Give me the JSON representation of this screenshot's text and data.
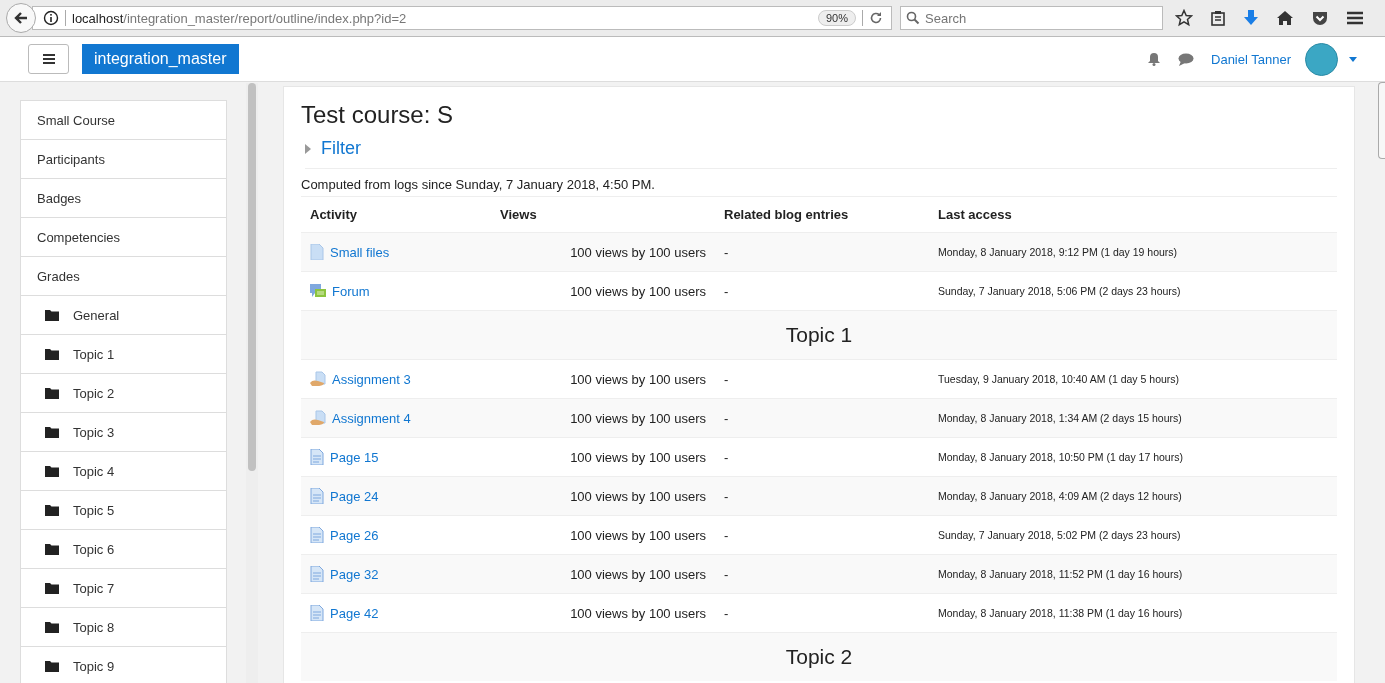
{
  "browser": {
    "url_host": "localhost",
    "url_path": "/integration_master/report/outline/index.php?id=2",
    "zoom": "90%",
    "search_placeholder": "Search"
  },
  "navbar": {
    "site_name": "integration_master",
    "user_name": "Daniel Tanner"
  },
  "sidebar": {
    "items": [
      {
        "label": "Small Course",
        "kind": "link"
      },
      {
        "label": "Participants",
        "kind": "link"
      },
      {
        "label": "Badges",
        "kind": "link"
      },
      {
        "label": "Competencies",
        "kind": "link"
      },
      {
        "label": "Grades",
        "kind": "link"
      },
      {
        "label": "General",
        "kind": "folder"
      },
      {
        "label": "Topic 1",
        "kind": "folder"
      },
      {
        "label": "Topic 2",
        "kind": "folder"
      },
      {
        "label": "Topic 3",
        "kind": "folder"
      },
      {
        "label": "Topic 4",
        "kind": "folder"
      },
      {
        "label": "Topic 5",
        "kind": "folder"
      },
      {
        "label": "Topic 6",
        "kind": "folder"
      },
      {
        "label": "Topic 7",
        "kind": "folder"
      },
      {
        "label": "Topic 8",
        "kind": "folder"
      },
      {
        "label": "Topic 9",
        "kind": "folder"
      }
    ]
  },
  "page": {
    "title": "Test course: S",
    "filter": "Filter",
    "note": "Computed from logs since Sunday, 7 January 2018, 4:50 PM.",
    "columns": [
      "Activity",
      "Views",
      "Related blog entries",
      "Last access"
    ],
    "rows": [
      {
        "kind": "file",
        "name": "Small files",
        "views": "100 views by 100 users",
        "blog": "-",
        "last_access": "Monday, 8 January 2018, 9:12 PM (1 day 19 hours)"
      },
      {
        "kind": "forum",
        "name": "Forum",
        "views": "100 views by 100 users",
        "blog": "-",
        "last_access": "Sunday, 7 January 2018, 5:06 PM (2 days 23 hours)"
      },
      {
        "kind": "section",
        "name": "Topic 1"
      },
      {
        "kind": "assignment",
        "name": "Assignment 3",
        "views": "100 views by 100 users",
        "blog": "-",
        "last_access": "Tuesday, 9 January 2018, 10:40 AM (1 day 5 hours)"
      },
      {
        "kind": "assignment",
        "name": "Assignment 4",
        "views": "100 views by 100 users",
        "blog": "-",
        "last_access": "Monday, 8 January 2018, 1:34 AM (2 days 15 hours)"
      },
      {
        "kind": "page",
        "name": "Page 15",
        "views": "100 views by 100 users",
        "blog": "-",
        "last_access": "Monday, 8 January 2018, 10:50 PM (1 day 17 hours)"
      },
      {
        "kind": "page",
        "name": "Page 24",
        "views": "100 views by 100 users",
        "blog": "-",
        "last_access": "Monday, 8 January 2018, 4:09 AM (2 days 12 hours)"
      },
      {
        "kind": "page",
        "name": "Page 26",
        "views": "100 views by 100 users",
        "blog": "-",
        "last_access": "Sunday, 7 January 2018, 5:02 PM (2 days 23 hours)"
      },
      {
        "kind": "page",
        "name": "Page 32",
        "views": "100 views by 100 users",
        "blog": "-",
        "last_access": "Monday, 8 January 2018, 11:52 PM (1 day 16 hours)"
      },
      {
        "kind": "page",
        "name": "Page 42",
        "views": "100 views by 100 users",
        "blog": "-",
        "last_access": "Monday, 8 January 2018, 11:38 PM (1 day 16 hours)"
      },
      {
        "kind": "section",
        "name": "Topic 2"
      }
    ]
  }
}
